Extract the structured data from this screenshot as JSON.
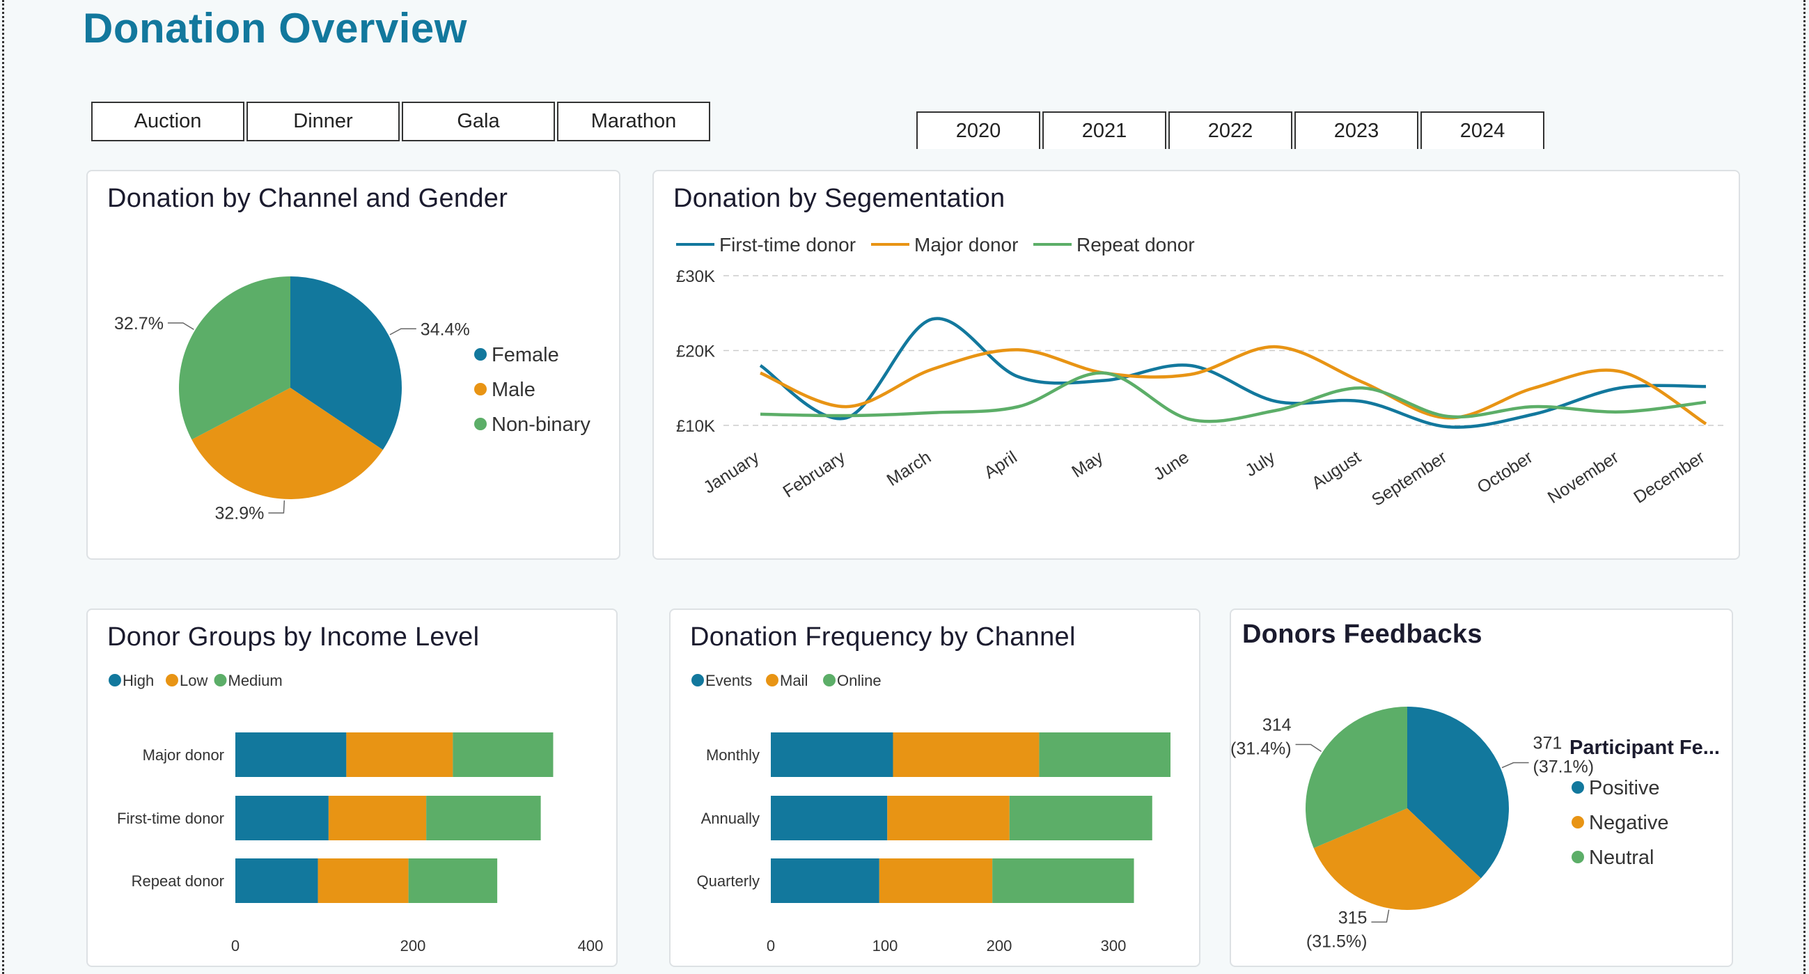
{
  "page": {
    "title": "Donation Overview"
  },
  "event_slicer": [
    "Auction",
    "Dinner",
    "Gala",
    "Marathon"
  ],
  "year_slicer": [
    "2020",
    "2021",
    "2022",
    "2023",
    "2024"
  ],
  "colors": {
    "blue": "#12789d",
    "orange": "#e89414",
    "green": "#5cae68",
    "title": "#12789d"
  },
  "cards": {
    "channel_gender": "Donation by Channel and Gender",
    "segmentation": "Donation by Segementation",
    "income": "Donor Groups by Income Level",
    "frequency": "Donation Frequency by Channel",
    "feedback": "Donors Feedbacks"
  },
  "chart_data": [
    {
      "id": "channel_gender",
      "type": "pie",
      "title": "Donation by Channel and Gender",
      "labels": [
        "Female",
        "Male",
        "Non-binary"
      ],
      "values": [
        34.4,
        32.9,
        32.7
      ],
      "value_labels": [
        "34.4%",
        "32.9%",
        "32.7%"
      ],
      "legend": "right"
    },
    {
      "id": "segmentation",
      "type": "line",
      "title": "Donation by Segementation",
      "categories": [
        "January",
        "February",
        "March",
        "April",
        "May",
        "June",
        "July",
        "August",
        "September",
        "October",
        "November",
        "December"
      ],
      "yticks": [
        "£10K",
        "£20K",
        "£30K"
      ],
      "ylim": [
        10000,
        30000
      ],
      "legend": "top-left",
      "grid": true,
      "series": [
        {
          "name": "First-time donor",
          "values": [
            18000,
            11000,
            24200,
            16500,
            16000,
            18000,
            13200,
            13200,
            9800,
            11500,
            15000,
            15200
          ]
        },
        {
          "name": "Major donor",
          "values": [
            17000,
            12500,
            17500,
            20100,
            17000,
            16800,
            20500,
            15800,
            11000,
            15000,
            17200,
            10200
          ]
        },
        {
          "name": "Repeat donor",
          "values": [
            11500,
            11300,
            11700,
            12500,
            17000,
            10800,
            12000,
            15000,
            11200,
            12500,
            11800,
            13100
          ]
        }
      ]
    },
    {
      "id": "income",
      "type": "bar",
      "orientation": "horizontal",
      "stacked": true,
      "title": "Donor Groups by Income Level",
      "categories": [
        "Major donor",
        "First-time donor",
        "Repeat donor"
      ],
      "xticks": [
        "0",
        "200",
        "400"
      ],
      "xlim": [
        0,
        400
      ],
      "legend": "top-left",
      "series": [
        {
          "name": "High",
          "values": [
            125,
            105,
            93
          ]
        },
        {
          "name": "Low",
          "values": [
            120,
            110,
            102
          ]
        },
        {
          "name": "Medium",
          "values": [
            113,
            129,
            100
          ]
        }
      ]
    },
    {
      "id": "frequency",
      "type": "bar",
      "orientation": "horizontal",
      "stacked": true,
      "title": "Donation Frequency by Channel",
      "categories": [
        "Monthly",
        "Annually",
        "Quarterly"
      ],
      "xticks": [
        "0",
        "100",
        "200",
        "300"
      ],
      "xlim": [
        0,
        350
      ],
      "legend": "top-left",
      "series": [
        {
          "name": "Events",
          "values": [
            107,
            102,
            95
          ]
        },
        {
          "name": "Mail",
          "values": [
            128,
            107,
            99
          ]
        },
        {
          "name": "Online",
          "values": [
            115,
            125,
            124
          ]
        }
      ]
    },
    {
      "id": "feedback",
      "type": "pie",
      "title": "Donors Feedbacks",
      "legend_title": "Participant Fe...",
      "labels": [
        "Positive",
        "Negative",
        "Neutral"
      ],
      "values": [
        371,
        315,
        314
      ],
      "value_labels": [
        "371",
        "315",
        "314"
      ],
      "pct_labels": [
        "(37.1%)",
        "(31.5%)",
        "(31.4%)"
      ],
      "legend": "right"
    }
  ]
}
